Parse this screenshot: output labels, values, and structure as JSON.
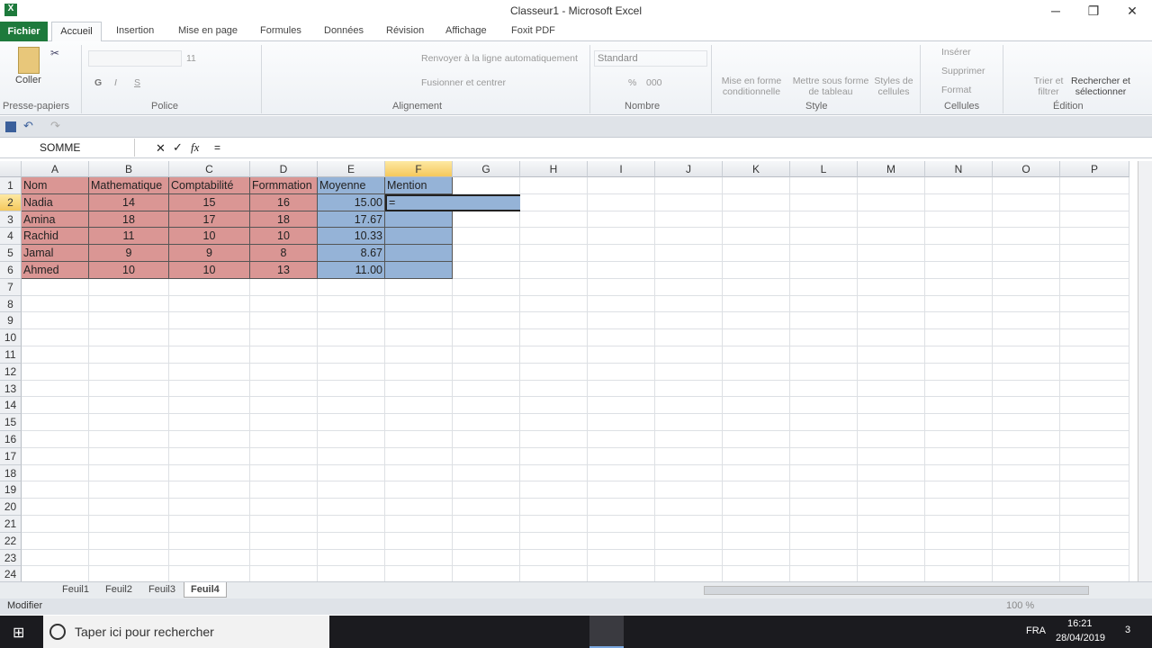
{
  "window": {
    "title": "Classeur1 - Microsoft Excel",
    "minimize": "─",
    "restore": "❐",
    "close": "✕"
  },
  "tabs": {
    "file": "Fichier",
    "items": [
      "Accueil",
      "Insertion",
      "Mise en page",
      "Formules",
      "Données",
      "Révision",
      "Affichage",
      "Foxit PDF"
    ]
  },
  "ribbon": {
    "clipboard": {
      "paste": "Coller",
      "group": "Presse-papiers"
    },
    "font": {
      "size": "11",
      "bold": "G",
      "italic": "I",
      "underline": "S",
      "group": "Police"
    },
    "alignment": {
      "wrap": "Renvoyer à la ligne automatiquement",
      "merge": "Fusionner et centrer",
      "group": "Alignement"
    },
    "number": {
      "format": "Standard",
      "percent": "%",
      "thousands": "000",
      "group": "Nombre"
    },
    "style": {
      "conditional": "Mise en forme conditionnelle",
      "table": "Mettre sous forme de tableau",
      "cell_styles": "Styles de cellules",
      "group": "Style"
    },
    "cells": {
      "insert": "Insérer",
      "delete": "Supprimer",
      "format": "Format",
      "group": "Cellules"
    },
    "editing": {
      "sort": "Trier et filtrer",
      "find": "Rechercher et sélectionner",
      "group": "Édition"
    }
  },
  "formula_bar": {
    "name_box": "SOMME",
    "cancel": "✕",
    "enter": "✓",
    "fx": "fx",
    "formula": "="
  },
  "sheet": {
    "columns": [
      "A",
      "B",
      "C",
      "D",
      "E",
      "F",
      "G",
      "H",
      "I",
      "J",
      "K",
      "L",
      "M",
      "N",
      "O",
      "P"
    ],
    "selected_column": "F",
    "selected_row": 2,
    "rows": [
      [
        "Nom",
        "Mathematique",
        "Comptabilité",
        "Formmation",
        "Moyenne",
        "Mention"
      ],
      [
        "Nadia",
        "14",
        "15",
        "16",
        "15.00",
        "="
      ],
      [
        "Amina",
        "18",
        "17",
        "18",
        "17.67",
        ""
      ],
      [
        "Rachid",
        "11",
        "10",
        "10",
        "10.33",
        ""
      ],
      [
        "Jamal",
        "9",
        "9",
        "8",
        "8.67",
        ""
      ],
      [
        "Ahmed",
        "10",
        "10",
        "13",
        "11.00",
        ""
      ]
    ],
    "row_count": 24,
    "colors": {
      "pink": "#da9694",
      "blue": "#95b3d7"
    }
  },
  "sheet_tabs": [
    "Feuil1",
    "Feuil2",
    "Feuil3",
    "Feuil4"
  ],
  "active_sheet": "Feuil4",
  "status": {
    "mode": "Modifier",
    "zoom": "100 %"
  },
  "taskbar": {
    "search": "Taper ici pour rechercher",
    "lang": "FRA",
    "time": "16:21",
    "date": "28/04/2019",
    "notif": "3"
  }
}
